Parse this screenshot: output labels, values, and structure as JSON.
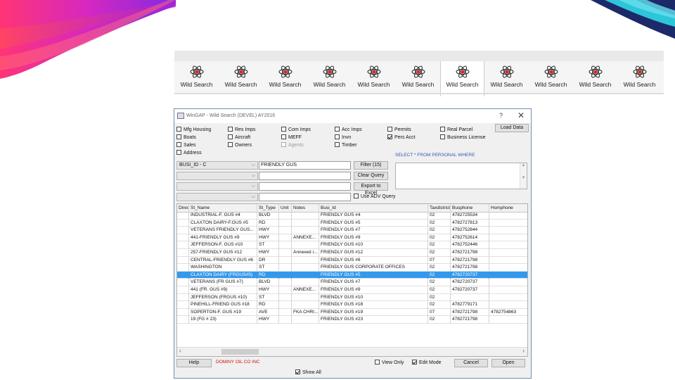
{
  "tabs": [
    {
      "label": "Wild Search",
      "active": false
    },
    {
      "label": "Wild Search",
      "active": false
    },
    {
      "label": "Wild Search",
      "active": false
    },
    {
      "label": "Wild Search",
      "active": false
    },
    {
      "label": "Wild Search",
      "active": false
    },
    {
      "label": "Wild Search",
      "active": false
    },
    {
      "label": "Wild Search",
      "active": true
    },
    {
      "label": "Wild Search",
      "active": false
    },
    {
      "label": "Wild Search",
      "active": false
    },
    {
      "label": "Wild Search",
      "active": false
    },
    {
      "label": "Wild Search",
      "active": false
    }
  ],
  "window": {
    "title": "WinGAP - Wild Search (DEVEL) AY2016",
    "help_glyph": "?",
    "close_glyph": "✕"
  },
  "checkboxes": [
    {
      "label": "Mfg Housing",
      "checked": false
    },
    {
      "label": "Boats",
      "checked": false
    },
    {
      "label": "Sales",
      "checked": false
    },
    {
      "label": "Address",
      "checked": false
    },
    {
      "label": "Res Imps",
      "checked": false
    },
    {
      "label": "Aircraft",
      "checked": false
    },
    {
      "label": "Owners",
      "checked": false
    },
    {
      "label": "Com Imps",
      "checked": false
    },
    {
      "label": "MEFF",
      "checked": false
    },
    {
      "label": "Agents",
      "checked": false,
      "disabled": true
    },
    {
      "label": "Acc Imps",
      "checked": false
    },
    {
      "label": "Invn",
      "checked": false
    },
    {
      "label": "Timber",
      "checked": false
    },
    {
      "label": "Permits",
      "checked": false
    },
    {
      "label": "Pers Acct",
      "checked": true
    },
    {
      "label": "Real Parcel",
      "checked": false
    },
    {
      "label": "Business License",
      "checked": false
    }
  ],
  "buttons": {
    "load_data": "Load Data",
    "filter": "Filter (15)",
    "clear_query": "Clear Query",
    "export_excel": "Export to Excel",
    "help": "Help",
    "cancel": "Cancel",
    "open": "Open"
  },
  "query": {
    "fields": [
      "BUSI_ID - C",
      "",
      "",
      ""
    ],
    "values": [
      "FRIENDLY GUS",
      "",
      "",
      ""
    ],
    "use_adv_query": {
      "label": "Use ADV Query",
      "checked": false
    },
    "sql": "SELECT * FROM PERSONAL WHERE"
  },
  "grid": {
    "columns": [
      "Direct",
      "St_Name",
      "St_Type",
      "Unit",
      "Notes",
      "Busi_Id",
      "Taxdistrict",
      "Busphone",
      "Homphone"
    ],
    "rows": [
      [
        "",
        "INDUSTRIAL-F. GUS #4",
        "BLVD",
        "",
        "",
        "FRIENDLY GUS #4",
        "02",
        "4782725534",
        ""
      ],
      [
        "",
        "CLAXTON DAIRY-F.GUS #5",
        "RD",
        "",
        "",
        "FRIENDLY GUS #5",
        "02",
        "4782727813",
        ""
      ],
      [
        "",
        "VETERANS FRIENDLY GUS...",
        "HWY",
        "",
        "",
        "FRIENDLY GUS #7",
        "02",
        "4782752844",
        ""
      ],
      [
        "",
        "441-FRIENDLY GUS #9",
        "HWY",
        "",
        "ANNEXE...",
        "FRIENDLY GUS #9",
        "02",
        "4782752614",
        ""
      ],
      [
        "",
        "JEFFERSON-F. GUS #10",
        "ST",
        "",
        "",
        "FRIENDLY GUS #10",
        "02",
        "4782752446",
        ""
      ],
      [
        "",
        "257-FRIENDLY GUS #12",
        "HWY",
        "",
        "Annexed i...",
        "FRIENDLY GUS #12",
        "02",
        "4782721798",
        ""
      ],
      [
        "",
        "CENTRAL-FRIENDLY GUS #6",
        "DR",
        "",
        "",
        "FRIENDLY GUS #6",
        "07",
        "4782721798",
        ""
      ],
      [
        "",
        "WASHINGTON",
        "ST",
        "",
        "",
        "FRIENDLY GUS CORPORATE OFFICES",
        "02",
        "4782721798",
        ""
      ],
      [
        "",
        "CLAXTON DAIRY (FRGUS#5)",
        "RD",
        "",
        "",
        "FRIENDLY GUS #5",
        "02",
        "4782720737",
        ""
      ],
      [
        "",
        "VETERANS (FR GUS #7)",
        "BLVD",
        "",
        "",
        "FRIENDLY GUS #7",
        "02",
        "4782720737",
        ""
      ],
      [
        "",
        "441  (FR. GUS #9)",
        "HWY",
        "",
        "ANNEXE...",
        "FRIENDLY GUS #9",
        "02",
        "4782720737",
        ""
      ],
      [
        "",
        "JEFFERSON (FRGUS #10)",
        "ST",
        "",
        "",
        "FRIENDLY GUS #10",
        "02",
        "",
        ""
      ],
      [
        "",
        "PINEHILL-FRIEND GUS #18",
        "RD",
        "",
        "",
        "FRIENDLY GUS #18",
        "02",
        "4782779171",
        ""
      ],
      [
        "",
        "SOPERTON-F. GUS #19",
        "AVE",
        "",
        "FKA CHRI...",
        "FRIENDLY GUS #19",
        "07",
        "4782721798",
        "4782754863"
      ],
      [
        "",
        "19    (FG # 23)",
        "HWY",
        "",
        "",
        "FRIENDLY GUS #23",
        "02",
        "4782721798",
        ""
      ]
    ],
    "selected_row": 8
  },
  "footer": {
    "company": "DOMINY OIL CO INC",
    "view_only": {
      "label": "View Only",
      "checked": false
    },
    "edit_mode": {
      "label": "Edit Mode",
      "checked": true
    },
    "show_all": {
      "label": "Show All",
      "checked": true
    }
  },
  "colors": {
    "selection": "#3399ee",
    "company_text": "#cc1111",
    "sql_text": "#3355bb"
  }
}
